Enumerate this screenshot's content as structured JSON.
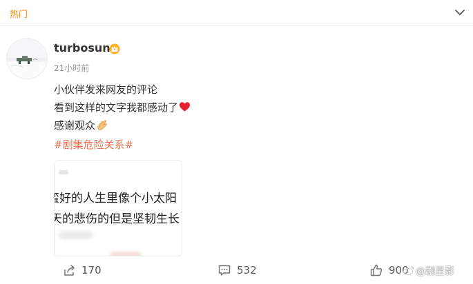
{
  "topbar": {
    "label": "热门"
  },
  "post": {
    "author": "turbosun",
    "timestamp": "21小时前",
    "lines": [
      "小伙伴发来网友的评论",
      "看到这样的文字我都感动了",
      "感谢观众"
    ],
    "hashtag": "#剧集危险关系#",
    "media": {
      "line1": "蛮好的人生里像个小太阳",
      "line2": "天的悲伤的但是坚韧生长"
    }
  },
  "actions": {
    "share_count": "170",
    "comment_count": "532",
    "like_count": "900"
  },
  "watermark": "@剧星影",
  "colors": {
    "accent_orange": "#ff8200",
    "hashtag": "#eb7350",
    "heart": "#e6222d"
  },
  "icons": [
    "chevron-down-icon",
    "crown-icon",
    "heart-icon",
    "clapping-hands-icon",
    "share-icon",
    "comment-icon",
    "like-icon",
    "weibo-icon"
  ]
}
